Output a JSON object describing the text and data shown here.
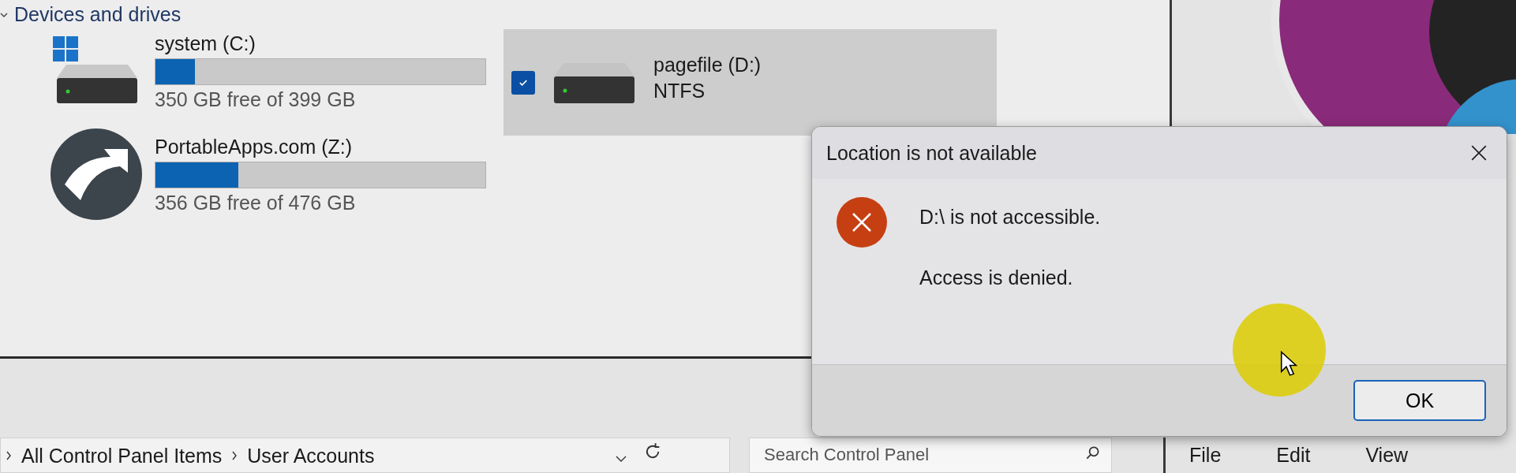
{
  "section": {
    "title": "Devices and drives",
    "expanded": true
  },
  "drives": [
    {
      "kind": "os",
      "name": "system (C:)",
      "level": 0.12,
      "free": "350 GB free of 399 GB",
      "selected": false
    },
    {
      "kind": "portable",
      "name": "PortableApps.com (Z:)",
      "level": 0.25,
      "free": "356 GB free of 476 GB",
      "selected": false
    },
    {
      "kind": "disk",
      "name": "pagefile (D:)",
      "filesystem": "NTFS",
      "selected": true
    }
  ],
  "dialog": {
    "title": "Location is not available",
    "message": "D:\\ is not accessible.",
    "detail": "Access is denied.",
    "buttons": [
      "OK"
    ]
  },
  "address_bar": {
    "path": [
      "All Control Panel Items",
      "User Accounts"
    ]
  },
  "search": {
    "placeholder": "Search Control Panel"
  },
  "menu": [
    "File",
    "Edit",
    "View"
  ]
}
